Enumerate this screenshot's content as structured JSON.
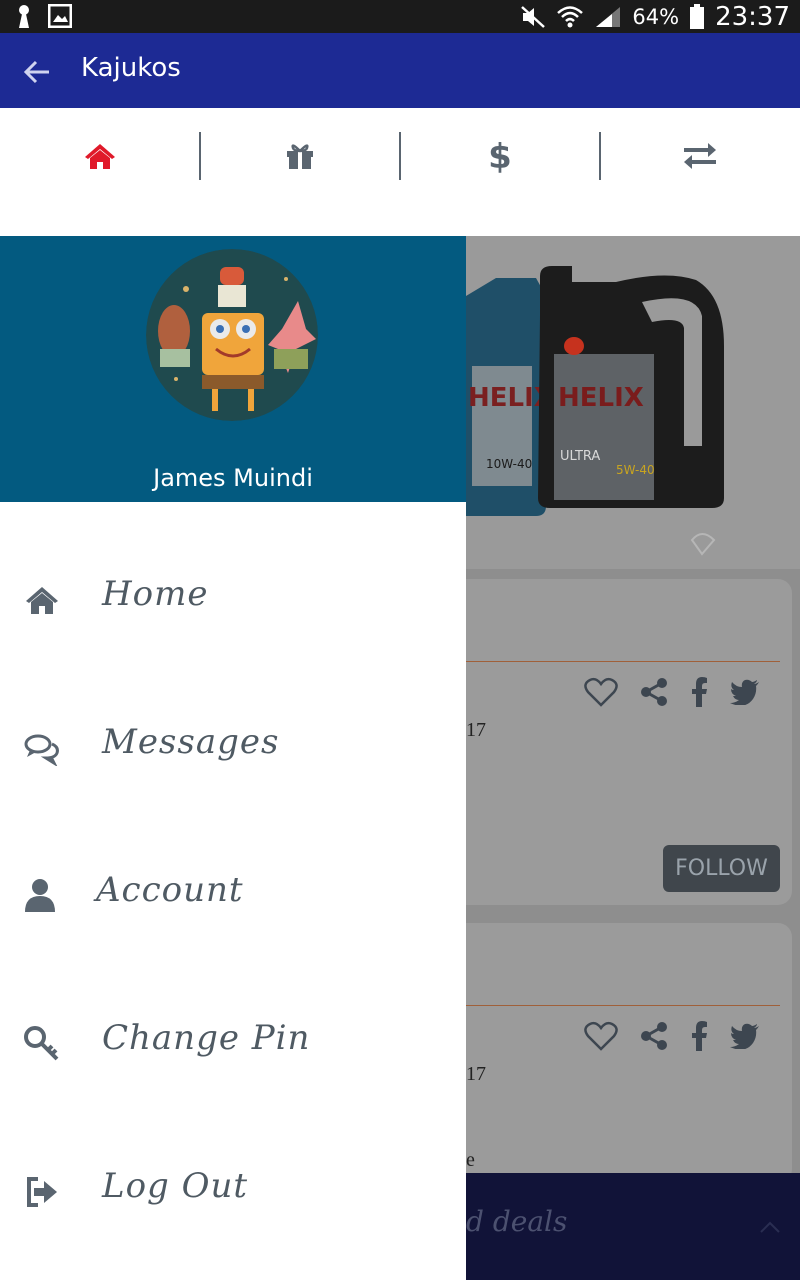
{
  "status_bar": {
    "battery_percent": "64%",
    "time": "23:37"
  },
  "app_bar": {
    "title": "Kajukos"
  },
  "tabs": [
    {
      "icon": "home-icon",
      "active": true
    },
    {
      "icon": "gift-icon",
      "active": false
    },
    {
      "icon": "dollar-icon",
      "active": false
    },
    {
      "icon": "exchange-icon",
      "active": false
    }
  ],
  "drawer": {
    "user_name": "James Muindi",
    "menu": [
      {
        "label": "Home",
        "icon": "home-icon"
      },
      {
        "label": "Messages",
        "icon": "messages-icon"
      },
      {
        "label": "Account",
        "icon": "user-icon"
      },
      {
        "label": "Change Pin",
        "icon": "key-icon"
      },
      {
        "label": "Log Out",
        "icon": "logout-icon"
      }
    ]
  },
  "background": {
    "product_brand": "HELIX",
    "product_variant": "ULTRA",
    "grade_front": "5W-40",
    "grade_back": "10W-40",
    "card1_fragment": "17",
    "card2_fragment": "17",
    "card2_extra": "e",
    "follow_label": "FOLLOW",
    "deals_fragment": "d deals"
  },
  "colors": {
    "app_bar": "#1d2a94",
    "drawer_header": "#035a80",
    "active_tab": "#e0192a",
    "inactive_icon": "#5a6570",
    "menu_text": "#4f5a63"
  }
}
